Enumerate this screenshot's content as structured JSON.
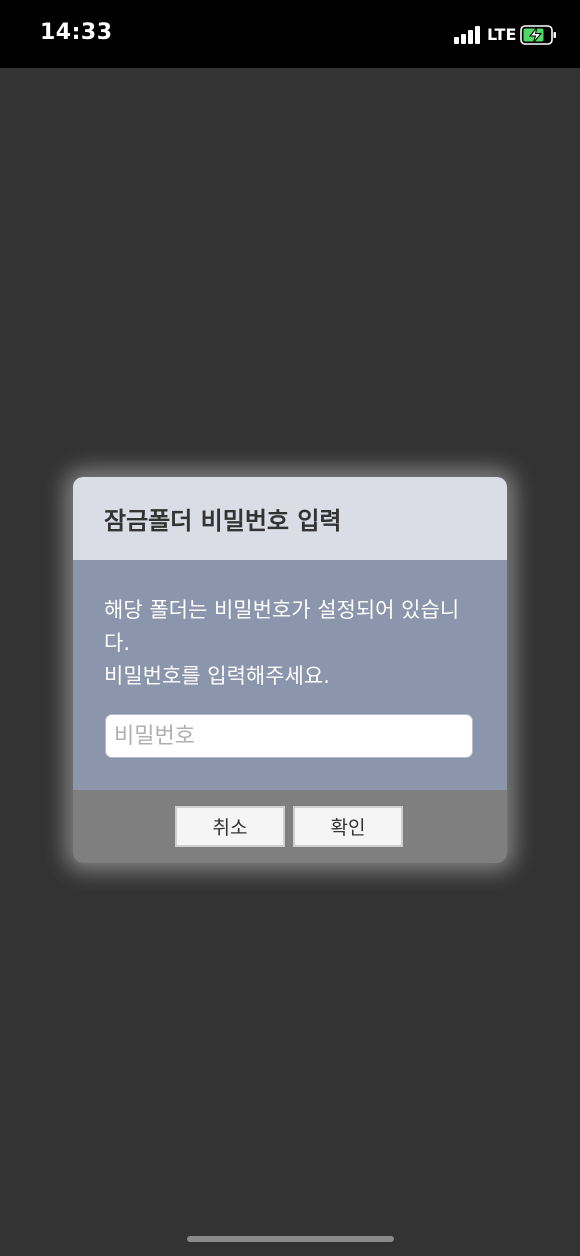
{
  "status_bar": {
    "time": "14:33",
    "network": "LTE",
    "signal_bars": 4,
    "battery_state": "charging",
    "battery_color": "#4cd964"
  },
  "dialog": {
    "title": "잠금폴더 비밀번호 입력",
    "message_line1": "해당 폴더는 비밀번호가 설정되어 있습니다.",
    "message_line2": "비밀번호를 입력해주세요.",
    "password_placeholder": "비밀번호",
    "password_value": "",
    "cancel_label": "취소",
    "confirm_label": "확인"
  },
  "colors": {
    "background": "#333333",
    "header": "#dadde6",
    "body": "#8b95ab",
    "footer": "#7f7f7f"
  }
}
